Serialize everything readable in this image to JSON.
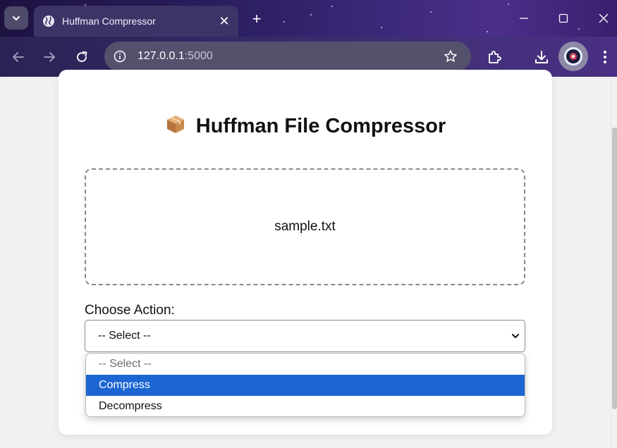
{
  "browser": {
    "tab_title": "Huffman Compressor",
    "tab_close": "✕",
    "new_tab": "+",
    "url_host": "127.0.0.1",
    "url_port": ":5000"
  },
  "page": {
    "heading_emoji": "📦",
    "heading": "Huffman File Compressor",
    "file_name": "sample.txt",
    "action_label": "Choose Action:",
    "select_value": "-- Select --",
    "options": [
      {
        "label": "-- Select --"
      },
      {
        "label": "Compress"
      },
      {
        "label": "Decompress"
      }
    ]
  },
  "colors": {
    "highlight": "#1b66d2",
    "titlebar": "#2a1d5e"
  }
}
